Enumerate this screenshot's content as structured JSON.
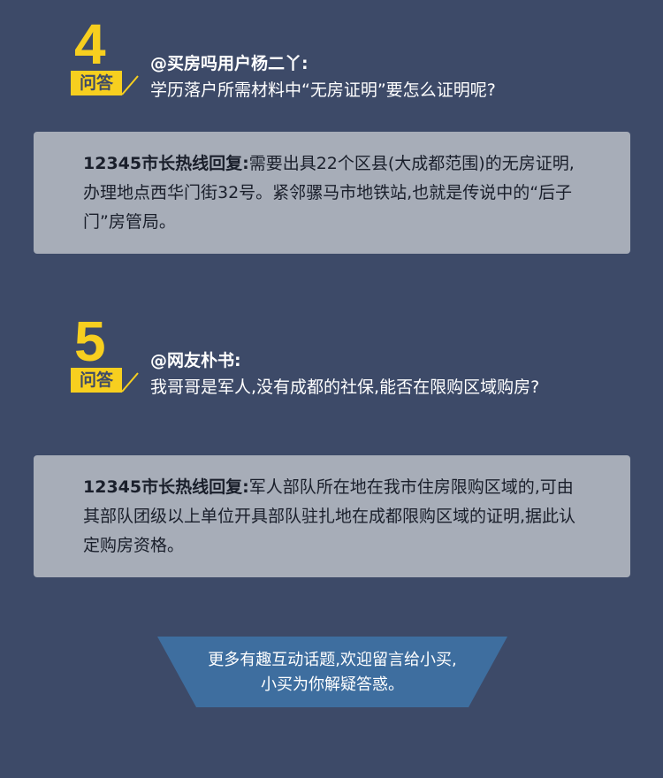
{
  "qa_items": [
    {
      "number": "4",
      "tag": "问答",
      "user": "@买房吗用户杨二丫:",
      "question": "学历落户所需材料中“无房证明”要怎么证明呢?",
      "answer_label": "12345市长热线回复:",
      "answer": "需要出具22个区县(大成都范围)的无房证明,办理地点西华门街32号。紧邻骡马市地铁站,也就是传说中的“后子门”房管局。"
    },
    {
      "number": "5",
      "tag": "问答",
      "user": "@网友朴书:",
      "question": "我哥哥是军人,没有成都的社保,能否在限购区域购房?",
      "answer_label": "12345市长热线回复:",
      "answer": "军人部队所在地在我市住房限购区域的,可由其部队团级以上单位开具部队驻扎地在成都限购区域的证明,据此认定购房资格。"
    }
  ],
  "footer": {
    "line1": "更多有趣互动话题,欢迎留言给小买,",
    "line2": "小买为你解疑答惑。"
  },
  "colors": {
    "background": "#3d4a68",
    "accent_yellow": "#f7cf1f",
    "answer_box": "#a7adb8",
    "footer_banner": "#3e6e9f"
  }
}
